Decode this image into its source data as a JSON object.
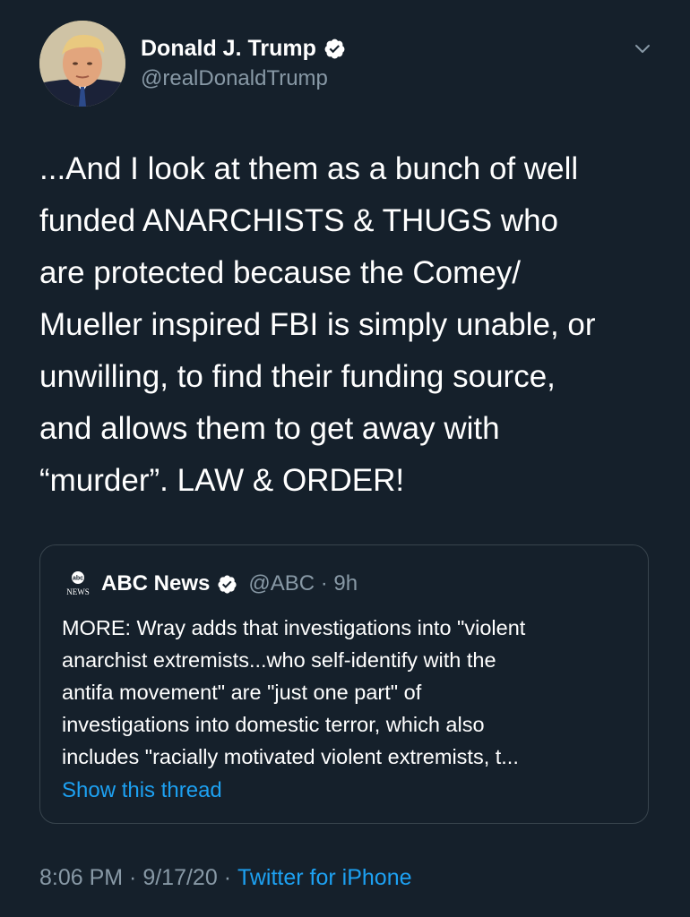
{
  "tweet": {
    "author": {
      "display_name": "Donald J. Trump",
      "handle": "@realDonaldTrump",
      "verified": true
    },
    "text": "...And I look at them as a bunch of well\nfunded ANARCHISTS & THUGS who\nare protected because the Comey/\nMueller inspired FBI is simply unable, or\nunwilling, to find their funding source,\nand allows them to get away with\n“murder”.  LAW & ORDER!",
    "menu_icon": "chevron-down-icon"
  },
  "quote": {
    "logo_text_top": "abc",
    "logo_text_bottom": "NEWS",
    "name": "ABC News",
    "handle": "@ABC",
    "separator": "·",
    "time": "9h",
    "text": "MORE: Wray adds that investigations into \"violent\nanarchist extremists...who self-identify with the\nantifa movement\" are \"just one part\" of\ninvestigations into domestic terror, which also\nincludes \"racially motivated violent extremists, t...",
    "show_thread": "Show this thread"
  },
  "footer": {
    "time": "8:06 PM",
    "date": "9/17/20",
    "separator": " · ",
    "source": "Twitter for iPhone"
  },
  "colors": {
    "background": "#15202b",
    "secondary_text": "#8899a6",
    "link": "#1da1f2",
    "border": "#38444d"
  }
}
